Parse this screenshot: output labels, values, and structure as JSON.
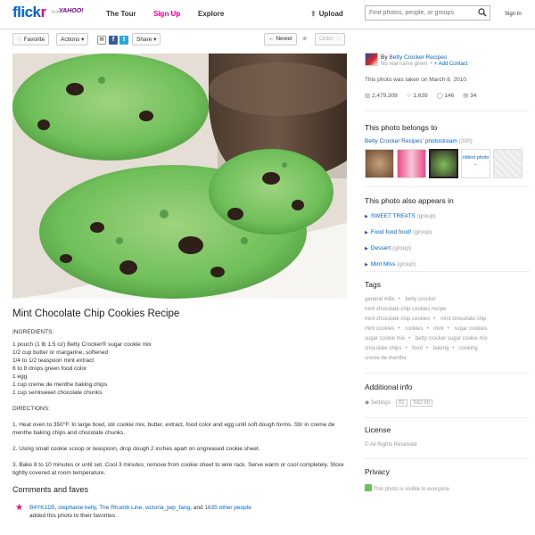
{
  "header": {
    "logo_blue": "flick",
    "logo_pink": "r",
    "logo_from": "from",
    "logo_yahoo": "YAHOO!",
    "nav": [
      "The Tour",
      "Sign Up",
      "Explore"
    ],
    "upload": "Upload",
    "search_placeholder": "Find photos, people, or groups",
    "signin": "Sign In"
  },
  "toolbar": {
    "favorite": "Favorite",
    "actions": "Actions",
    "share": "Share",
    "newer": "Newer",
    "older": "Older"
  },
  "photo": {
    "title": "Mint Chocolate Chip Cookies Recipe",
    "ingredients_heading": "INGREDIENTS:",
    "ingredients": [
      "1 pouch (1 lb 1.5 oz) Betty Crocker® sugar cookie mix",
      "1/2 cup butter or margarine, softened",
      "1/4 to 1/2 teaspoon mint extract",
      "6 to 8 drops green food color",
      "1 egg",
      "1 cup creme de menthe baking chips",
      "1 cup semisweet chocolate chunks"
    ],
    "directions_heading": "DIRECTIONS:",
    "directions": [
      "1. Heat oven to 350°F. In large bowl, stir cookie mix, butter, extract, food color and egg until soft dough forms. Stir in creme de menthe baking chips and chocolate chunks.",
      "2. Using small cookie scoop or teaspoon, drop dough 2 inches apart on ungreased cookie sheet.",
      "3. Bake 8 to 10 minutes or until set. Cool 3 minutes; remove from cookie sheet to wire rack. Serve warm or cool completely. Store tightly covered at room temperature."
    ]
  },
  "comments": {
    "heading": "Comments and faves",
    "faver_links": [
      "B4YK1D5",
      "stephanie kelly",
      "The Rhumb Line",
      "victoria_jwp_fang"
    ],
    "and_text": ", and",
    "others_link": "1635 other people",
    "fave_suffix": "added this photo to their favorites."
  },
  "owner": {
    "by": "By",
    "name": "Betty Crocker Recipes",
    "real_name": "No real name given",
    "add_contact": "+ Add Contact",
    "taken": "This photo was taken on March 8, 2010."
  },
  "stats": {
    "views": "2,479,308",
    "faves": "1,639",
    "comments": "146",
    "notes": "34"
  },
  "belongs": {
    "heading": "This photo belongs to",
    "stream_link": "Betty Crocker Recipes' photostream",
    "stream_count": "(200)",
    "oldest_label": "oldest photo"
  },
  "appears": {
    "heading": "This photo also appears in",
    "albums": [
      {
        "name": "SWEET TREATS",
        "type": "(group)"
      },
      {
        "name": "Food food food!",
        "type": "(group)"
      },
      {
        "name": "Dessert",
        "type": "(group)"
      },
      {
        "name": "Mint Miss",
        "type": "(group)"
      }
    ]
  },
  "tags": {
    "heading": "Tags",
    "items": [
      "general mills",
      "betty crocker",
      "mint chocolate chip cookies recipe",
      "mint chocolate chip cookies",
      "mint chocolate chip",
      "mint cookies",
      "cookies",
      "mint",
      "sugar cookies",
      "sugar cookie mix",
      "betty crocker sugar cookie mix",
      "chocolate chips",
      "food",
      "baking",
      "cooking",
      "creme de menthe"
    ]
  },
  "info": {
    "heading": "Additional info",
    "settings": "Settings:",
    "aperture": "f/1",
    "iso": "ISO 50"
  },
  "license": {
    "heading": "License",
    "text": "All Rights Reserved"
  },
  "privacy": {
    "heading": "Privacy",
    "text": "This photo is visible to everyone"
  },
  "colors": {
    "link": "#0063dc",
    "pink": "#ff0084",
    "mint": "#6fbf5a"
  }
}
